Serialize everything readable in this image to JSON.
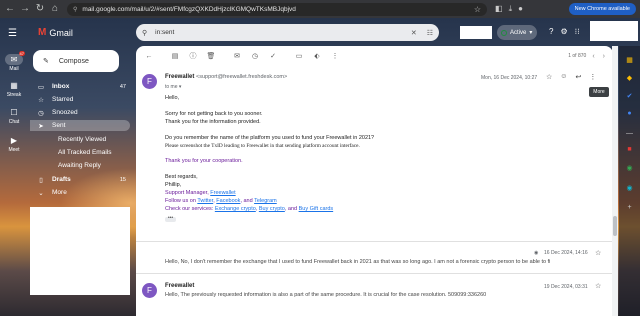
{
  "browser": {
    "url": "mail.google.com/mail/u/2/#sent/FMfcgzQXKDdHjzclKGMQwTKsMBJqbjvd",
    "new_chrome": "New Chrome available",
    "nav_back": "←",
    "nav_forward": "→",
    "nav_reload": "↻",
    "nav_home": "⌂"
  },
  "rail": {
    "menu": "☰",
    "items": [
      {
        "label": "Mail",
        "icon": "✉",
        "badge": "47"
      },
      {
        "label": "Streak",
        "icon": "▦"
      },
      {
        "label": "Chat",
        "icon": "☐"
      },
      {
        "label": "Meet",
        "icon": "▶"
      }
    ]
  },
  "header": {
    "app_name": "Gmail",
    "search_query": "in:sent",
    "status": "Active",
    "help_icon": "?",
    "settings_icon": "⚙",
    "apps_icon": "⋮⋮⋮"
  },
  "nav": {
    "compose": "Compose",
    "items": [
      {
        "label": "Inbox",
        "count": "47",
        "bold": true,
        "icon": "▭"
      },
      {
        "label": "Starred",
        "icon": "☆"
      },
      {
        "label": "Snoozed",
        "icon": "◷"
      },
      {
        "label": "Sent",
        "icon": "➤",
        "selected": true
      },
      {
        "label": "Recently Viewed",
        "sub": true
      },
      {
        "label": "All Tracked Emails",
        "sub": true
      },
      {
        "label": "Awaiting Reply",
        "sub": true
      },
      {
        "label": "Drafts",
        "count": "15",
        "bold": true,
        "icon": "▯"
      },
      {
        "label": "More",
        "icon": "⌄"
      }
    ]
  },
  "toolbar": {
    "pager": "1 of 870",
    "tooltip": "More"
  },
  "message1": {
    "avatar": "F",
    "sender_name": "Freewallet",
    "sender_email": "<support@freewallet.freshdesk.com>",
    "to": "to me ▾",
    "date": "Mon, 16 Dec 2024, 10:27",
    "lines": {
      "l1": "Hello,",
      "l2": "Sorry for not getting back to you sooner.",
      "l3": "Thank you for the information provided.",
      "l4": "Do you remember the name of the platform you used to fund your Freewallet in 2021?",
      "l5": "Please screenshot the TxID leading to Freewallet in that sending platform account interface.",
      "l6": "Thank you for your cooperation.",
      "l7": "Best regards,",
      "l8": "Phillip,",
      "l9_prefix": "Support Manager, ",
      "l9_link": "Freewallet",
      "l10_prefix": "Follow us on ",
      "l10_twitter": "Twitter",
      "l10_sep1": ", ",
      "l10_facebook": "Facebook",
      "l10_sep2": ", and ",
      "l10_telegram": "Telegram",
      "l11_prefix": "Check our services: ",
      "l11_exchange": "Exchange crypto",
      "l11_sep1": ", ",
      "l11_buy": "Buy crypto",
      "l11_sep2": ", and ",
      "l11_gift": "Buy Gift cards",
      "dots": "•••"
    }
  },
  "message2": {
    "date": "16 Dec 2024, 14:16",
    "preview": "Hello, No, I don't remember the exchange that I used to fund Freewallet back in 2021 as that was so long ago. I am not a forensic crypto person to be able to fi"
  },
  "message3": {
    "avatar": "F",
    "sender_name": "Freewallet",
    "date": "19 Dec 2024, 03:31",
    "preview": "Hello, The previously requested information is also a part of the same procedure. It is crucial for the case resolution. 509099:336260"
  }
}
